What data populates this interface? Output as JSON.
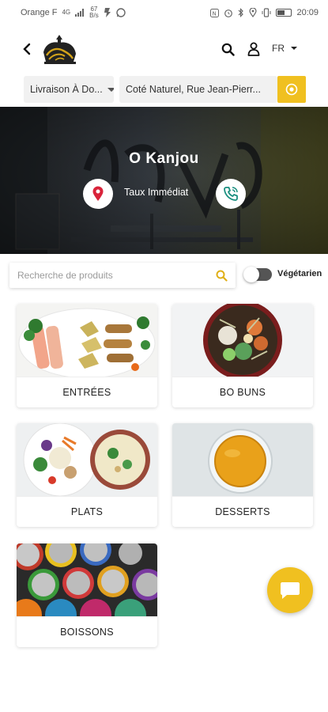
{
  "status_bar": {
    "carrier": "Orange F",
    "net_top": "4G",
    "speed_top": "67",
    "speed_unit": "B/s",
    "time": "20:09"
  },
  "header": {
    "back_icon": "chevron-left-icon",
    "logo_icon": "kanjou-logo",
    "search_icon": "search-icon",
    "user_icon": "user-icon",
    "language": "FR"
  },
  "selectors": {
    "delivery_mode": "Livraison À Do...",
    "address": "Coté Naturel, Rue Jean-Pierr...",
    "locate_icon": "target-icon"
  },
  "hero": {
    "title": "O Kanjou",
    "subtitle": "Taux Immédiat",
    "location_icon": "map-pin-icon",
    "phone_icon": "phone-icon"
  },
  "search": {
    "placeholder": "Recherche de produits",
    "value": ""
  },
  "vegetarian_toggle": {
    "label": "Végétarien",
    "on": false
  },
  "categories": [
    {
      "label": "ENTRÉES"
    },
    {
      "label": "BO BUNS"
    },
    {
      "label": "PLATS"
    },
    {
      "label": "DESSERTS"
    },
    {
      "label": "BOISSONS"
    }
  ],
  "chat": {
    "icon": "chat-bubble-icon"
  },
  "colors": {
    "accent": "#f0c020",
    "pin_red": "#d9233a",
    "phone_teal": "#1a8f7f"
  }
}
